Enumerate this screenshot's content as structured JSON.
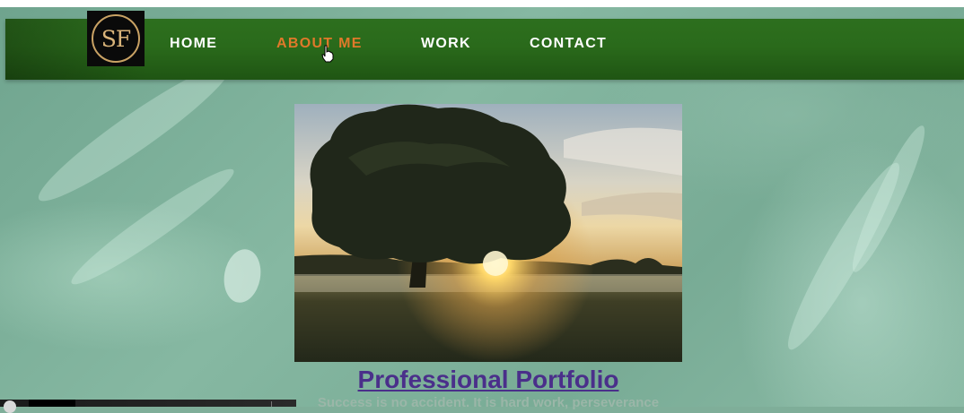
{
  "brand": {
    "logo_text": "SF"
  },
  "nav": {
    "items": [
      {
        "label": "HOME",
        "active": false
      },
      {
        "label": "ABOUT ME",
        "active": true
      },
      {
        "label": "WORK",
        "active": false
      },
      {
        "label": "CONTACT",
        "active": false
      }
    ]
  },
  "hero": {
    "image": "tree-sunrise-meadow"
  },
  "main": {
    "title": "Professional Portfolio",
    "tagline": "Success is no accident. It is hard work, perseverance"
  },
  "colors": {
    "navbar": "#2a6a1b",
    "active_nav": "#e0792a",
    "title_link": "#4a2f8a",
    "background": "#7fae99",
    "logo_gold": "#c9a264"
  }
}
